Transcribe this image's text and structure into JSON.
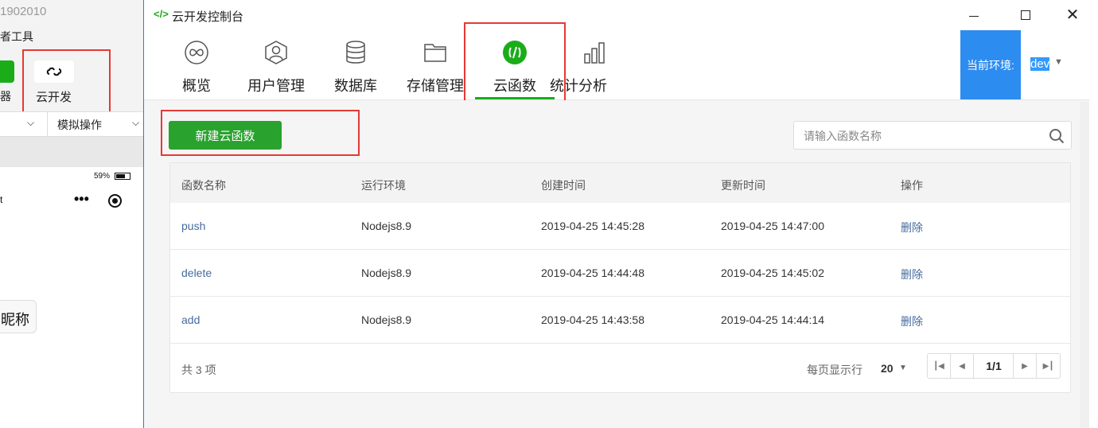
{
  "background_ide": {
    "title": "1902010",
    "menu_text": "者工具",
    "simulator_label": "器",
    "cloud_button_label": "云开发",
    "mock_action_label": "模拟操作",
    "battery_text": "59%",
    "left_fragment": "t",
    "nickname_text": "昵称"
  },
  "window": {
    "title": "云开发控制台"
  },
  "nav": {
    "items": [
      {
        "label": "概览",
        "icon": "infinity-icon"
      },
      {
        "label": "用户管理",
        "icon": "user-icon"
      },
      {
        "label": "数据库",
        "icon": "database-icon"
      },
      {
        "label": "存储管理",
        "icon": "folder-icon"
      },
      {
        "label": "云函数",
        "icon": "cloud-function-icon",
        "active": true
      },
      {
        "label": "统计分析",
        "icon": "bar-chart-icon"
      }
    ]
  },
  "env": {
    "label": "当前环境:",
    "value": "dev"
  },
  "toolbar": {
    "new_button": "新建云函数",
    "search_placeholder": "请输入函数名称"
  },
  "table": {
    "headers": [
      "函数名称",
      "运行环境",
      "创建时间",
      "更新时间",
      "操作"
    ],
    "rows": [
      {
        "name": "push",
        "runtime": "Nodejs8.9",
        "created": "2019-04-25 14:45:28",
        "updated": "2019-04-25 14:47:00",
        "action": "删除"
      },
      {
        "name": "delete",
        "runtime": "Nodejs8.9",
        "created": "2019-04-25 14:44:48",
        "updated": "2019-04-25 14:45:02",
        "action": "删除"
      },
      {
        "name": "add",
        "runtime": "Nodejs8.9",
        "created": "2019-04-25 14:43:58",
        "updated": "2019-04-25 14:44:14",
        "action": "删除"
      }
    ],
    "total": "共 3 项",
    "per_page_label": "每页显示行",
    "per_page_value": "20",
    "page_indicator": "1/1"
  },
  "colors": {
    "accent_green": "#1aad19",
    "env_blue": "#2d8cf0",
    "highlight_red": "#e53935",
    "link_blue": "#466c9e"
  }
}
